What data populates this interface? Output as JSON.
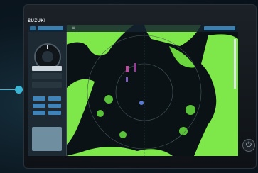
{
  "device": {
    "brand": "SUZUKI"
  },
  "topbar": {
    "menu_icon": "menu-icon",
    "left_button": "",
    "right_button": ""
  },
  "panel": {
    "widgets": [
      "compass-widget",
      "readout-1",
      "readout-2",
      "button-grid",
      "mini-map"
    ]
  },
  "power": {
    "icon": "power-icon",
    "glyph": "⏻"
  },
  "callout": {
    "color": "#3ab6d4"
  },
  "colors": {
    "radar_green": "#7ee84a",
    "radar_bg": "#0a1216",
    "accent_blue": "#3f83b8",
    "echo_magenta": "#c04aa0"
  }
}
